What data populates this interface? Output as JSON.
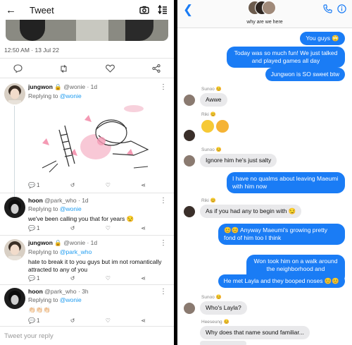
{
  "twitter": {
    "header": {
      "title": "Tweet"
    },
    "timestamp": "12:50 AM · 13 Jul 22",
    "replies": [
      {
        "name": "jungwon",
        "handle": "@wonie · 1d",
        "replying_prefix": "Replying to",
        "replying_to": "@wonie",
        "text": "",
        "likes_count": "1"
      },
      {
        "name": "hoon",
        "handle": "@park_who · 1d",
        "replying_prefix": "Replying to",
        "replying_to": "@wonie",
        "text": "we've been calling you that for years 😒",
        "likes_count": "1"
      },
      {
        "name": "jungwon",
        "handle": "@wonie · 1d",
        "replying_prefix": "Replying to",
        "replying_to": "@park_who",
        "text": "hate to break it to you guys but im not romantically attracted to any of you",
        "likes_count": "1"
      },
      {
        "name": "hoon",
        "handle": "@park_who · 3h",
        "replying_prefix": "Replying to",
        "replying_to": "@wonie",
        "text": "👏🏻👏🏻👏🏻",
        "likes_count": "1"
      }
    ],
    "reply_placeholder": "Tweet your reply"
  },
  "imessage": {
    "group_name": "why are we here",
    "messages": [
      {
        "text": "You guys 🙄"
      },
      {
        "text": "Today was so much fun! We just talked and played games all day"
      },
      {
        "text": "Jungwon is SO sweet btw"
      },
      {
        "sender": "Sunoo 😊",
        "text": "Awwe"
      },
      {
        "sender": "Riki 😊"
      },
      {
        "sender": "Sunoo 😊",
        "text": "Ignore him he's just salty"
      },
      {
        "text": "I have no qualms about leaving Maeumi with him now"
      },
      {
        "sender": "Riki 😊",
        "text": "As if you had any to begin with 😏"
      },
      {
        "text": "😊😊 Anyway Maeumi's growing pretty fond of him too I think"
      },
      {
        "text": "Won took him on a walk around the neighborhood and everything"
      },
      {
        "text": "He met Layla and they booped noses 😊😊"
      },
      {
        "sender": "Sunoo 😊",
        "text": "Who's Layla?"
      },
      {
        "sender": "Heeseung 😊",
        "text": "Why does that name sound familiar..."
      }
    ]
  },
  "colors": {
    "imessage_blue": "#1a7cf5",
    "twitter_blue": "#1d9bf0",
    "bubble_gray": "#e9e9eb"
  }
}
